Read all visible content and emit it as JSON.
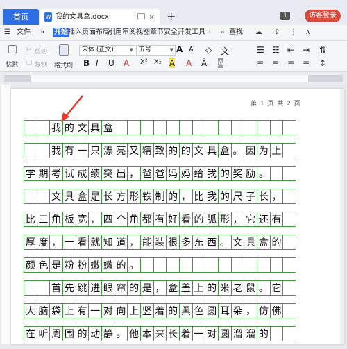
{
  "tabs": {
    "home": "首页",
    "doc_title": "我的文具盒.docx",
    "badge": "1",
    "login": "访客登录"
  },
  "menu": [
    "文件",
    "开始",
    "插入",
    "页面布局",
    "引用",
    "审阅",
    "视图",
    "章节",
    "安全",
    "开发工具",
    "查找"
  ],
  "ribbon": {
    "cut": "剪切",
    "paste": "粘贴",
    "copy": "复制",
    "format_painter": "格式刷",
    "font": "宋体 (正文)",
    "size": "五号",
    "bold": "B",
    "italic": "I",
    "underline": "U",
    "sup": "X²",
    "sub": "X₂"
  },
  "page_number": "第 1 页 共 2 页",
  "document_lines": [
    "我的文具盒",
    "我有一只漂亮又精致的的文具盒。因为上",
    "学期考试成绩突出，爸爸妈妈给我的奖励。",
    "文具盒是长方形铁制的，比我的尺子长，",
    "比三角板宽，四个角都有好看的弧形，它还有",
    "厚度，一看就知道，能装很多东西。文具盒的",
    "颜色是粉粉嫩嫩的。",
    "首先跳进眼帘的是，盒盖上的米老鼠。它",
    "大脑袋上有一对向上竖着的黑色圆耳朵，仿佛",
    "在听周围的动静。他本来长着一对圆溜溜的"
  ],
  "first_line_indents": [
    2,
    2,
    0,
    2,
    0,
    0,
    0,
    2,
    0,
    0
  ],
  "colors": {
    "grid": "#3d9a3d",
    "accent": "#2f6fe4",
    "login": "#d94a3a",
    "arrow": "#e23a2a"
  }
}
